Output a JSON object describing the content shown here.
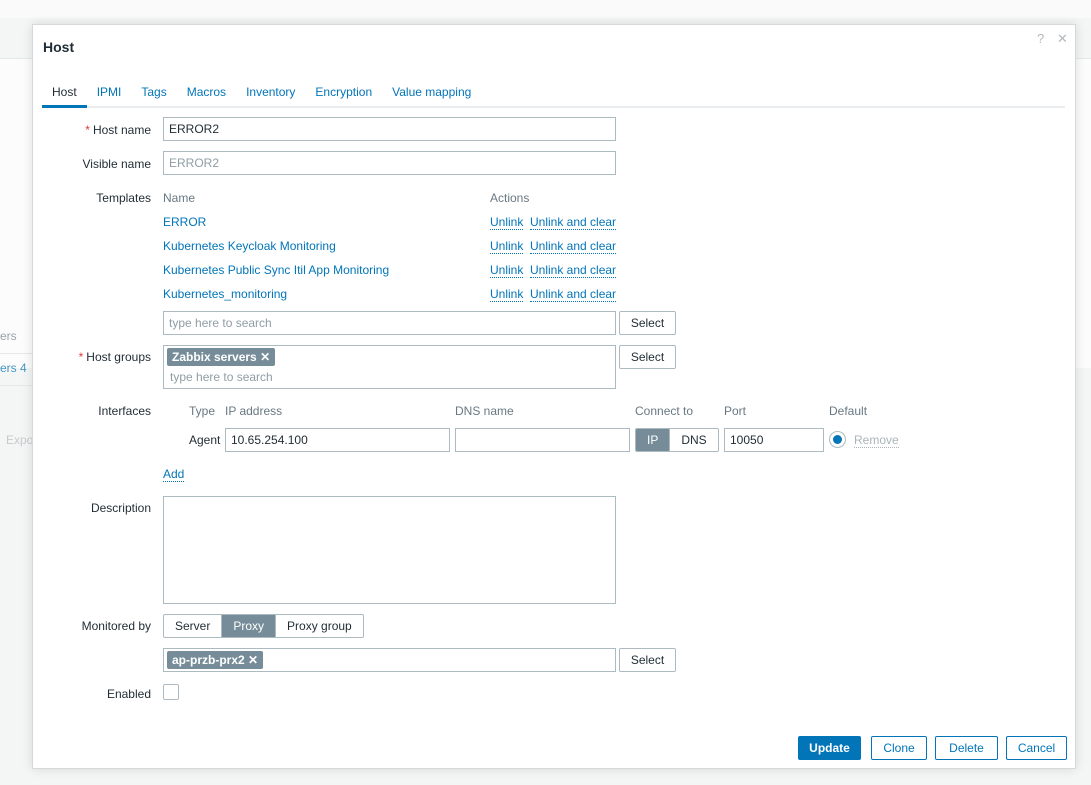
{
  "background": {
    "fragments": [
      "ers",
      "ers 4",
      "Expo"
    ]
  },
  "dialog": {
    "title": "Host",
    "help_icon": "?",
    "close_icon": "✕"
  },
  "tabs": [
    "Host",
    "IPMI",
    "Tags",
    "Macros",
    "Inventory",
    "Encryption",
    "Value mapping"
  ],
  "form": {
    "host_name": {
      "label": "Host name",
      "value": "ERROR2"
    },
    "visible_name": {
      "label": "Visible name",
      "placeholder": "ERROR2"
    },
    "templates": {
      "label": "Templates",
      "col_name": "Name",
      "col_actions": "Actions",
      "unlink": "Unlink",
      "unlink_clear": "Unlink and clear",
      "items": [
        "ERROR",
        "Kubernetes Keycloak Monitoring",
        "Kubernetes Public Sync Itil App Monitoring",
        "Kubernetes_monitoring"
      ],
      "search_placeholder": "type here to search",
      "select": "Select"
    },
    "host_groups": {
      "label": "Host groups",
      "chips": [
        "Zabbix servers"
      ],
      "search_placeholder": "type here to search",
      "select": "Select"
    },
    "interfaces": {
      "label": "Interfaces",
      "headers": {
        "type": "Type",
        "ip": "IP address",
        "dns": "DNS name",
        "connect": "Connect to",
        "port": "Port",
        "default": "Default"
      },
      "rows": [
        {
          "type": "Agent",
          "ip": "10.65.254.100",
          "dns": "",
          "connect_options": [
            "IP",
            "DNS"
          ],
          "connect_selected": "IP",
          "port": "10050",
          "remove": "Remove"
        }
      ],
      "add": "Add"
    },
    "description": {
      "label": "Description",
      "value": ""
    },
    "monitored_by": {
      "label": "Monitored by",
      "options": [
        "Server",
        "Proxy",
        "Proxy group"
      ],
      "selected": "Proxy",
      "proxy_chips": [
        "ap-przb-prx2"
      ],
      "select": "Select"
    },
    "enabled": {
      "label": "Enabled",
      "checked": false
    }
  },
  "footer": {
    "update": "Update",
    "clone": "Clone",
    "delete": "Delete",
    "cancel": "Cancel"
  }
}
